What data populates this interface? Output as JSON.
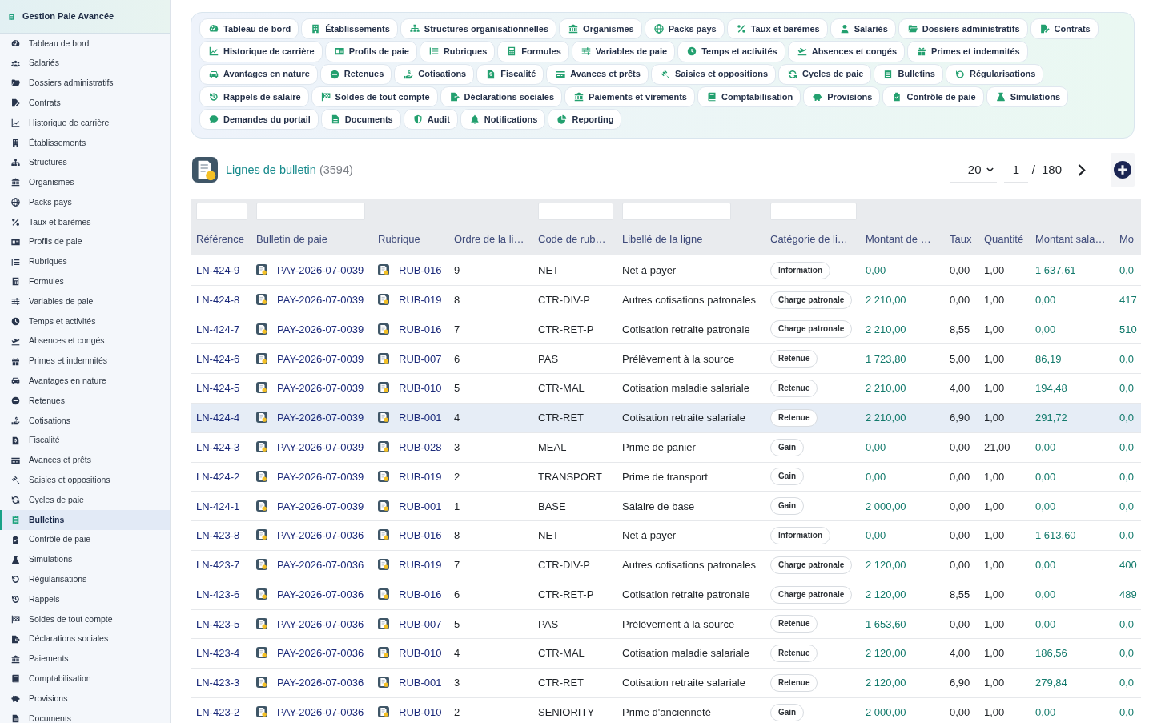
{
  "sidebar": {
    "title": "Gestion Paie Avancée",
    "items": [
      {
        "label": "Tableau de bord",
        "selected": false
      },
      {
        "label": "Salariés",
        "selected": false
      },
      {
        "label": "Dossiers administratifs",
        "selected": false
      },
      {
        "label": "Contrats",
        "selected": false
      },
      {
        "label": "Historique de carrière",
        "selected": false
      },
      {
        "label": "Établissements",
        "selected": false
      },
      {
        "label": "Structures",
        "selected": false
      },
      {
        "label": "Organismes",
        "selected": false
      },
      {
        "label": "Packs pays",
        "selected": false
      },
      {
        "label": "Taux et barèmes",
        "selected": false
      },
      {
        "label": "Profils de paie",
        "selected": false
      },
      {
        "label": "Rubriques",
        "selected": false
      },
      {
        "label": "Formules",
        "selected": false
      },
      {
        "label": "Variables de paie",
        "selected": false
      },
      {
        "label": "Temps et activités",
        "selected": false
      },
      {
        "label": "Absences et congés",
        "selected": false
      },
      {
        "label": "Primes et indemnités",
        "selected": false
      },
      {
        "label": "Avantages en nature",
        "selected": false
      },
      {
        "label": "Retenues",
        "selected": false
      },
      {
        "label": "Cotisations",
        "selected": false
      },
      {
        "label": "Fiscalité",
        "selected": false
      },
      {
        "label": "Avances et prêts",
        "selected": false
      },
      {
        "label": "Saisies et oppositions",
        "selected": false
      },
      {
        "label": "Cycles de paie",
        "selected": false
      },
      {
        "label": "Bulletins",
        "selected": true
      },
      {
        "label": "Contrôle de paie",
        "selected": false
      },
      {
        "label": "Simulations",
        "selected": false
      },
      {
        "label": "Régularisations",
        "selected": false
      },
      {
        "label": "Rappels",
        "selected": false
      },
      {
        "label": "Soldes de tout compte",
        "selected": false
      },
      {
        "label": "Déclarations sociales",
        "selected": false
      },
      {
        "label": "Paiements",
        "selected": false
      },
      {
        "label": "Comptabilisation",
        "selected": false
      },
      {
        "label": "Provisions",
        "selected": false
      },
      {
        "label": "Documents",
        "selected": false
      }
    ]
  },
  "module_nav": {
    "items": [
      "Tableau de bord",
      "Établissements",
      "Structures organisationnelles",
      "Organismes",
      "Packs pays",
      "Taux et barèmes",
      "Salariés",
      "Dossiers administratifs",
      "Contrats",
      "Historique de carrière",
      "Profils de paie",
      "Rubriques",
      "Formules",
      "Variables de paie",
      "Temps et activités",
      "Absences et congés",
      "Primes et indemnités",
      "Avantages en nature",
      "Retenues",
      "Cotisations",
      "Fiscalité",
      "Avances et prêts",
      "Saisies et oppositions",
      "Cycles de paie",
      "Bulletins",
      "Régularisations",
      "Rappels de salaire",
      "Soldes de tout compte",
      "Déclarations sociales",
      "Paiements et virements",
      "Comptabilisation",
      "Provisions",
      "Contrôle de paie",
      "Simulations",
      "Demandes du portail",
      "Documents",
      "Audit",
      "Notifications",
      "Reporting"
    ]
  },
  "list_header": {
    "title": "Lignes de bulletin",
    "count": "(3594)",
    "page_size": "20",
    "page": "1",
    "page_separator": "/",
    "total_pages": "180"
  },
  "table": {
    "columns": [
      {
        "label": "Référence",
        "kind": "link",
        "filter": true
      },
      {
        "label": "Bulletin de paie",
        "kind": "doc_link",
        "filter": true
      },
      {
        "label": "Rubrique",
        "kind": "doc_link",
        "filter": false
      },
      {
        "label": "Ordre de la li…",
        "kind": "text",
        "filter": false
      },
      {
        "label": "Code de rub…",
        "kind": "text",
        "filter": true
      },
      {
        "label": "Libellé de la ligne",
        "kind": "text",
        "filter": true
      },
      {
        "label": "Catégorie de li…",
        "kind": "badge",
        "filter": true
      },
      {
        "label": "Montant de …",
        "kind": "amount",
        "filter": false
      },
      {
        "label": "Taux",
        "kind": "text",
        "filter": false
      },
      {
        "label": "Quantité",
        "kind": "text",
        "filter": false
      },
      {
        "label": "Montant sala…",
        "kind": "amount",
        "filter": false
      },
      {
        "label": "Mo",
        "kind": "amount",
        "filter": false
      }
    ],
    "rows": [
      {
        "selected": false,
        "cells": [
          "LN-424-9",
          "PAY-2026-07-0039",
          "RUB-016",
          "9",
          "NET",
          "Net à payer",
          "Information",
          "0,00",
          "0,00",
          "1,00",
          "1 637,61",
          "0,0"
        ]
      },
      {
        "selected": false,
        "cells": [
          "LN-424-8",
          "PAY-2026-07-0039",
          "RUB-019",
          "8",
          "CTR-DIV-P",
          "Autres cotisations patronales",
          "Charge patronale",
          "2 210,00",
          "0,00",
          "1,00",
          "0,00",
          "417"
        ]
      },
      {
        "selected": false,
        "cells": [
          "LN-424-7",
          "PAY-2026-07-0039",
          "RUB-016",
          "7",
          "CTR-RET-P",
          "Cotisation retraite patronale",
          "Charge patronale",
          "2 210,00",
          "8,55",
          "1,00",
          "0,00",
          "510"
        ]
      },
      {
        "selected": false,
        "cells": [
          "LN-424-6",
          "PAY-2026-07-0039",
          "RUB-007",
          "6",
          "PAS",
          "Prélèvement à la source",
          "Retenue",
          "1 723,80",
          "5,00",
          "1,00",
          "86,19",
          "0,0"
        ]
      },
      {
        "selected": false,
        "cells": [
          "LN-424-5",
          "PAY-2026-07-0039",
          "RUB-010",
          "5",
          "CTR-MAL",
          "Cotisation maladie salariale",
          "Retenue",
          "2 210,00",
          "4,00",
          "1,00",
          "194,48",
          "0,0"
        ]
      },
      {
        "selected": true,
        "cells": [
          "LN-424-4",
          "PAY-2026-07-0039",
          "RUB-001",
          "4",
          "CTR-RET",
          "Cotisation retraite salariale",
          "Retenue",
          "2 210,00",
          "6,90",
          "1,00",
          "291,72",
          "0,0"
        ]
      },
      {
        "selected": false,
        "cells": [
          "LN-424-3",
          "PAY-2026-07-0039",
          "RUB-028",
          "3",
          "MEAL",
          "Prime de panier",
          "Gain",
          "0,00",
          "0,00",
          "21,00",
          "0,00",
          "0,0"
        ]
      },
      {
        "selected": false,
        "cells": [
          "LN-424-2",
          "PAY-2026-07-0039",
          "RUB-019",
          "2",
          "TRANSPORT",
          "Prime de transport",
          "Gain",
          "0,00",
          "0,00",
          "1,00",
          "0,00",
          "0,0"
        ]
      },
      {
        "selected": false,
        "cells": [
          "LN-424-1",
          "PAY-2026-07-0039",
          "RUB-001",
          "1",
          "BASE",
          "Salaire de base",
          "Gain",
          "2 000,00",
          "0,00",
          "1,00",
          "0,00",
          "0,0"
        ]
      },
      {
        "selected": false,
        "cells": [
          "LN-423-8",
          "PAY-2026-07-0036",
          "RUB-016",
          "8",
          "NET",
          "Net à payer",
          "Information",
          "0,00",
          "0,00",
          "1,00",
          "1 613,60",
          "0,0"
        ]
      },
      {
        "selected": false,
        "cells": [
          "LN-423-7",
          "PAY-2026-07-0036",
          "RUB-019",
          "7",
          "CTR-DIV-P",
          "Autres cotisations patronales",
          "Charge patronale",
          "2 120,00",
          "0,00",
          "1,00",
          "0,00",
          "400"
        ]
      },
      {
        "selected": false,
        "cells": [
          "LN-423-6",
          "PAY-2026-07-0036",
          "RUB-016",
          "6",
          "CTR-RET-P",
          "Cotisation retraite patronale",
          "Charge patronale",
          "2 120,00",
          "8,55",
          "1,00",
          "0,00",
          "489"
        ]
      },
      {
        "selected": false,
        "cells": [
          "LN-423-5",
          "PAY-2026-07-0036",
          "RUB-007",
          "5",
          "PAS",
          "Prélèvement à la source",
          "Retenue",
          "1 653,60",
          "0,00",
          "1,00",
          "0,00",
          "0,0"
        ]
      },
      {
        "selected": false,
        "cells": [
          "LN-423-4",
          "PAY-2026-07-0036",
          "RUB-010",
          "4",
          "CTR-MAL",
          "Cotisation maladie salariale",
          "Retenue",
          "2 120,00",
          "4,00",
          "1,00",
          "186,56",
          "0,0"
        ]
      },
      {
        "selected": false,
        "cells": [
          "LN-423-3",
          "PAY-2026-07-0036",
          "RUB-001",
          "3",
          "CTR-RET",
          "Cotisation retraite salariale",
          "Retenue",
          "2 120,00",
          "6,90",
          "1,00",
          "279,84",
          "0,0"
        ]
      },
      {
        "selected": false,
        "cells": [
          "LN-423-2",
          "PAY-2026-07-0036",
          "RUB-010",
          "2",
          "SENIORITY",
          "Prime d'ancienneté",
          "Gain",
          "2 000,00",
          "0,00",
          "1,00",
          "0,00",
          "0,0"
        ]
      }
    ]
  }
}
